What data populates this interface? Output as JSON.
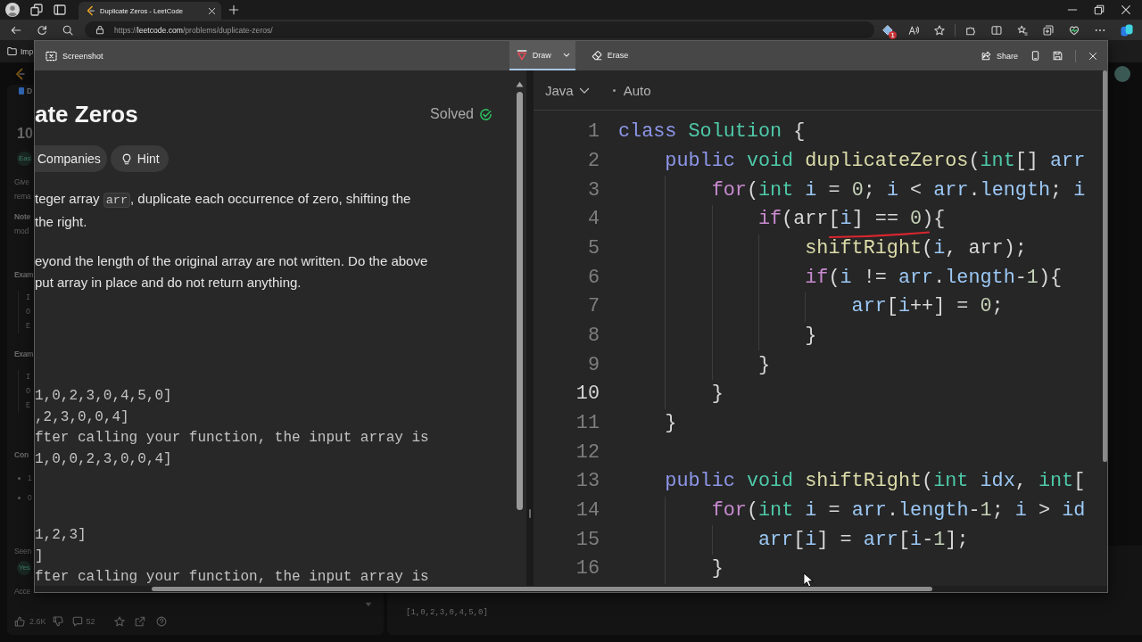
{
  "browser": {
    "tabs": [
      {
        "title": "Duplicate Zeros - LeetCode",
        "selected": true
      }
    ],
    "address": {
      "scheme": "https://",
      "host": "leetcode.com",
      "path": "/problems/duplicate-zeros/"
    },
    "extension_badge": "1",
    "bookmarks": [
      {
        "label": "Imp"
      }
    ]
  },
  "background_page": {
    "sidebar_fragments": [
      {
        "kind": "tab",
        "text": "D"
      },
      {
        "kind": "number",
        "text": "10"
      },
      {
        "kind": "tag",
        "text": "Eas"
      },
      {
        "kind": "text",
        "text": "Give"
      },
      {
        "kind": "text",
        "text": "rema"
      },
      {
        "kind": "strong",
        "text": "Note"
      },
      {
        "kind": "text",
        "text": "mod"
      },
      {
        "kind": "subheading",
        "text": "Exam"
      },
      {
        "kind": "mono",
        "text": "I"
      },
      {
        "kind": "mono",
        "text": "O"
      },
      {
        "kind": "mono",
        "text": "E"
      },
      {
        "kind": "subheading",
        "text": "Exam"
      },
      {
        "kind": "mono",
        "text": "I"
      },
      {
        "kind": "mono",
        "text": "O"
      },
      {
        "kind": "mono",
        "text": "E"
      },
      {
        "kind": "heading",
        "text": "Con"
      },
      {
        "kind": "bullet",
        "text": "1"
      },
      {
        "kind": "bullet",
        "text": "0"
      },
      {
        "kind": "text",
        "text": "Seen"
      },
      {
        "kind": "tag",
        "text": "Yes"
      },
      {
        "kind": "text",
        "text": "Acce"
      }
    ],
    "likes": "2.6K",
    "comments": "52",
    "testcase": "[1,0,2,3,0,4,5,0]"
  },
  "screenshot_tool": {
    "title": "Screenshot",
    "tools": [
      {
        "kind": "draw",
        "label": "Draw",
        "selected": true
      },
      {
        "kind": "erase",
        "label": "Erase",
        "selected": false
      }
    ],
    "share_label": "Share"
  },
  "capture": {
    "description": {
      "title": "ate Zeros",
      "status": "Solved",
      "chips": [
        {
          "kind": "plain",
          "label": "Companies"
        },
        {
          "kind": "bulb",
          "label": "Hint"
        }
      ],
      "paragraphs": [
        {
          "lines": [
            [
              {
                "kind": "text",
                "text": "teger array "
              },
              {
                "kind": "code",
                "text": "arr"
              },
              {
                "kind": "text",
                "text": ", duplicate each occurrence of zero, shifting the"
              }
            ],
            [
              {
                "kind": "text",
                "text": "the right."
              }
            ]
          ]
        },
        {
          "lines": [
            [
              {
                "kind": "text",
                "text": "eyond the length of the original array are not written. Do the above"
              }
            ],
            [
              {
                "kind": "text",
                "text": "put array in place and do not return anything."
              }
            ]
          ]
        }
      ],
      "examples": [
        {
          "lines": [
            "1,0,2,3,0,4,5,0]",
            ",2,3,0,0,4]",
            "fter calling your function, the input array is",
            "1,0,0,2,3,0,0,4]"
          ]
        },
        {
          "lines": [
            "1,2,3]",
            "]",
            "fter calling your function, the input array is"
          ]
        }
      ]
    },
    "editor": {
      "language": "Java",
      "mode": "Auto",
      "lines": [
        {
          "number": "1",
          "current": false,
          "tokens": [
            {
              "kind": "keyword",
              "text": "class "
            },
            {
              "kind": "type",
              "text": "Solution"
            },
            {
              "kind": "plain",
              "text": " {"
            }
          ],
          "children": [
            {
              "number": "2",
              "current": false,
              "tokens": [
                {
                  "kind": "keyword",
                  "text": "public "
                },
                {
                  "kind": "type",
                  "text": "void "
                },
                {
                  "kind": "function",
                  "text": "duplicateZeros"
                },
                {
                  "kind": "plain",
                  "text": "("
                },
                {
                  "kind": "type",
                  "text": "int"
                },
                {
                  "kind": "plain",
                  "text": "[] "
                },
                {
                  "kind": "variable",
                  "text": "arr"
                }
              ],
              "children": [
                {
                  "number": "3",
                  "current": false,
                  "tokens": [
                    {
                      "kind": "control",
                      "text": "for"
                    },
                    {
                      "kind": "plain",
                      "text": "("
                    },
                    {
                      "kind": "type",
                      "text": "int"
                    },
                    {
                      "kind": "variable",
                      "text": " i"
                    },
                    {
                      "kind": "plain",
                      "text": " = "
                    },
                    {
                      "kind": "number",
                      "text": "0"
                    },
                    {
                      "kind": "plain",
                      "text": "; "
                    },
                    {
                      "kind": "variable",
                      "text": "i"
                    },
                    {
                      "kind": "plain",
                      "text": " < "
                    },
                    {
                      "kind": "variable",
                      "text": "arr"
                    },
                    {
                      "kind": "plain",
                      "text": "."
                    },
                    {
                      "kind": "variable",
                      "text": "length"
                    },
                    {
                      "kind": "plain",
                      "text": "; "
                    },
                    {
                      "kind": "variable",
                      "text": "i"
                    }
                  ],
                  "children": [
                    {
                      "number": "4",
                      "current": false,
                      "tokens": [
                        {
                          "kind": "control",
                          "text": "if"
                        },
                        {
                          "kind": "plain",
                          "text": "("
                        },
                        {
                          "kind": "plain",
                          "text": "arr"
                        },
                        {
                          "kind": "plain",
                          "text": "["
                        },
                        {
                          "kind": "variable",
                          "text": "i"
                        },
                        {
                          "kind": "plain",
                          "text": "] == "
                        },
                        {
                          "kind": "number",
                          "text": "0"
                        },
                        {
                          "kind": "plain",
                          "text": "){"
                        }
                      ],
                      "children": [
                        {
                          "number": "5",
                          "current": false,
                          "tokens": [
                            {
                              "kind": "function",
                              "text": "shiftRight"
                            },
                            {
                              "kind": "plain",
                              "text": "("
                            },
                            {
                              "kind": "variable",
                              "text": "i"
                            },
                            {
                              "kind": "plain",
                              "text": ", "
                            },
                            {
                              "kind": "plain",
                              "text": "arr"
                            },
                            {
                              "kind": "plain",
                              "text": ");"
                            }
                          ]
                        },
                        {
                          "number": "6",
                          "current": false,
                          "tokens": [
                            {
                              "kind": "control",
                              "text": "if"
                            },
                            {
                              "kind": "plain",
                              "text": "("
                            },
                            {
                              "kind": "variable",
                              "text": "i"
                            },
                            {
                              "kind": "plain",
                              "text": " != "
                            },
                            {
                              "kind": "variable",
                              "text": "arr"
                            },
                            {
                              "kind": "plain",
                              "text": "."
                            },
                            {
                              "kind": "variable",
                              "text": "length"
                            },
                            {
                              "kind": "plain",
                              "text": "-"
                            },
                            {
                              "kind": "number",
                              "text": "1"
                            },
                            {
                              "kind": "plain",
                              "text": "){"
                            }
                          ],
                          "children": [
                            {
                              "number": "7",
                              "current": false,
                              "tokens": [
                                {
                                  "kind": "variable",
                                  "text": "arr"
                                },
                                {
                                  "kind": "plain",
                                  "text": "["
                                },
                                {
                                  "kind": "variable",
                                  "text": "i"
                                },
                                {
                                  "kind": "plain",
                                  "text": "++] = "
                                },
                                {
                                  "kind": "number",
                                  "text": "0"
                                },
                                {
                                  "kind": "plain",
                                  "text": ";"
                                }
                              ]
                            }
                          ]
                        },
                        {
                          "number": "8",
                          "current": false,
                          "tokens": [
                            {
                              "kind": "plain",
                              "text": "}"
                            }
                          ]
                        }
                      ]
                    },
                    {
                      "number": "9",
                      "current": false,
                      "tokens": [
                        {
                          "kind": "plain",
                          "text": "}"
                        }
                      ]
                    }
                  ]
                },
                {
                  "number": "10",
                  "current": true,
                  "tokens": [
                    {
                      "kind": "plain",
                      "text": "}"
                    }
                  ]
                }
              ]
            },
            {
              "number": "11",
              "current": false,
              "tokens": [
                {
                  "kind": "plain",
                  "text": "}"
                }
              ]
            },
            {
              "number": "12",
              "current": false
            },
            {
              "number": "13",
              "current": false,
              "tokens": [
                {
                  "kind": "keyword",
                  "text": "public "
                },
                {
                  "kind": "type",
                  "text": "void "
                },
                {
                  "kind": "function",
                  "text": "shiftRight"
                },
                {
                  "kind": "plain",
                  "text": "("
                },
                {
                  "kind": "type",
                  "text": "int"
                },
                {
                  "kind": "variable",
                  "text": " idx"
                },
                {
                  "kind": "plain",
                  "text": ", "
                },
                {
                  "kind": "type",
                  "text": "int"
                },
                {
                  "kind": "plain",
                  "text": "["
                }
              ],
              "children": [
                {
                  "number": "14",
                  "current": false,
                  "tokens": [
                    {
                      "kind": "control",
                      "text": "for"
                    },
                    {
                      "kind": "plain",
                      "text": "("
                    },
                    {
                      "kind": "type",
                      "text": "int"
                    },
                    {
                      "kind": "variable",
                      "text": " i"
                    },
                    {
                      "kind": "plain",
                      "text": " = "
                    },
                    {
                      "kind": "variable",
                      "text": "arr"
                    },
                    {
                      "kind": "plain",
                      "text": "."
                    },
                    {
                      "kind": "variable",
                      "text": "length"
                    },
                    {
                      "kind": "plain",
                      "text": "-"
                    },
                    {
                      "kind": "number",
                      "text": "1"
                    },
                    {
                      "kind": "plain",
                      "text": "; "
                    },
                    {
                      "kind": "variable",
                      "text": "i"
                    },
                    {
                      "kind": "plain",
                      "text": " > "
                    },
                    {
                      "kind": "variable",
                      "text": "id"
                    }
                  ],
                  "children": [
                    {
                      "number": "15",
                      "current": false,
                      "tokens": [
                        {
                          "kind": "variable",
                          "text": "arr"
                        },
                        {
                          "kind": "plain",
                          "text": "["
                        },
                        {
                          "kind": "variable",
                          "text": "i"
                        },
                        {
                          "kind": "plain",
                          "text": "] = "
                        },
                        {
                          "kind": "variable",
                          "text": "arr"
                        },
                        {
                          "kind": "plain",
                          "text": "["
                        },
                        {
                          "kind": "variable",
                          "text": "i"
                        },
                        {
                          "kind": "plain",
                          "text": "-"
                        },
                        {
                          "kind": "number",
                          "text": "1"
                        },
                        {
                          "kind": "plain",
                          "text": "];"
                        }
                      ]
                    }
                  ]
                },
                {
                  "number": "16",
                  "current": false,
                  "tokens": [
                    {
                      "kind": "plain",
                      "text": "}"
                    }
                  ]
                }
              ]
            }
          ]
        }
      ]
    }
  }
}
